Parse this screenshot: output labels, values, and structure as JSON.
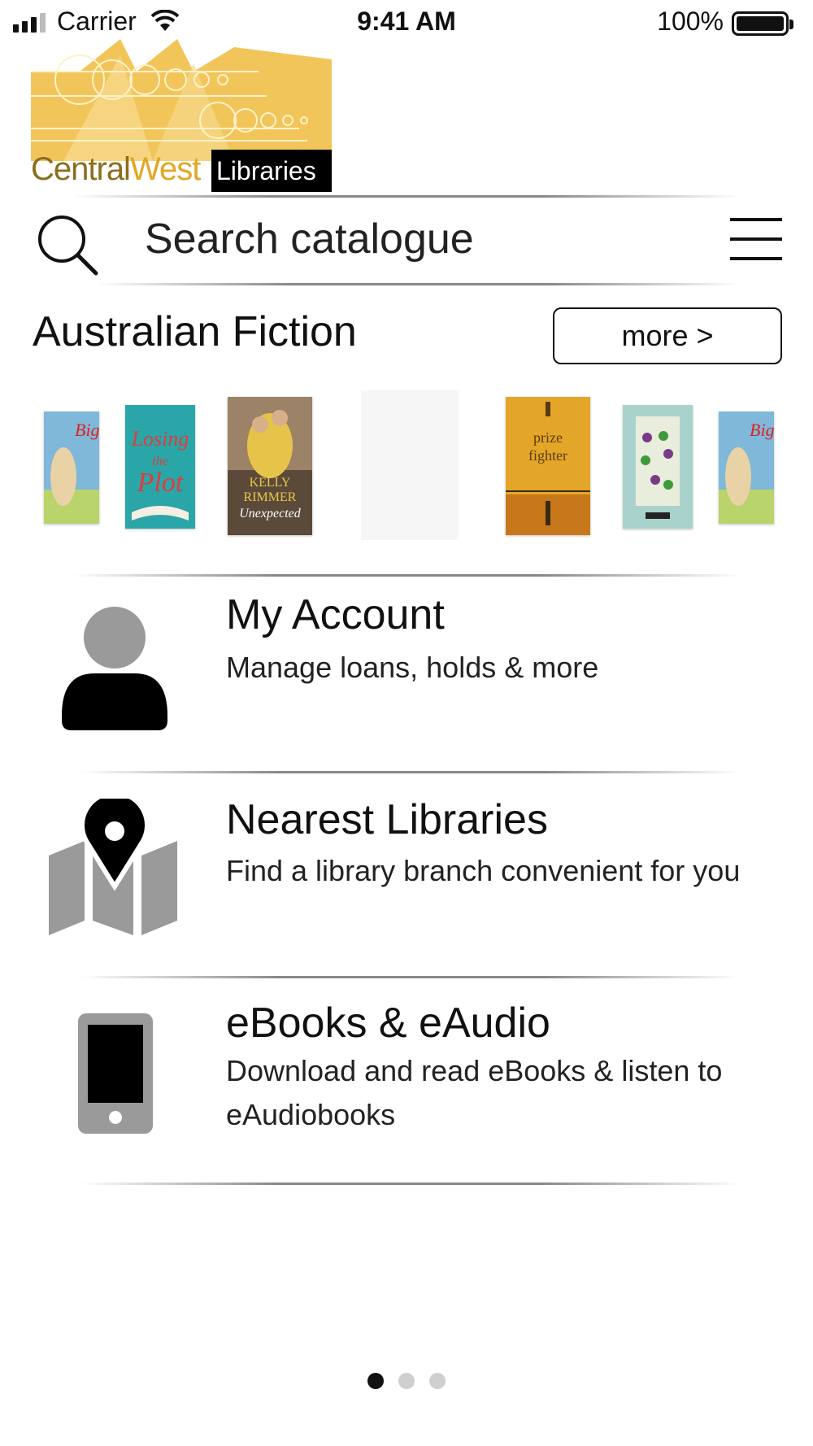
{
  "status_bar": {
    "carrier": "Carrier",
    "time": "9:41 AM",
    "battery": "100%"
  },
  "logo": {
    "text_main": "Central",
    "text_accent": "West",
    "badge": "Libraries"
  },
  "search": {
    "placeholder": "Search catalogue"
  },
  "featured": {
    "title": "Australian Fiction",
    "more_label": "more >",
    "books": [
      {
        "cover_color": "#7fb8d8"
      },
      {
        "cover_color": "#2aa6a8",
        "cover_text": "Losing the Plot"
      },
      {
        "cover_color": "#c9a34a",
        "cover_text": "KELLY RIMMER Unexpected"
      },
      {
        "cover_color": "#f4f4f4"
      },
      {
        "cover_color": "#e4a628",
        "cover_text": "prize fighter"
      },
      {
        "cover_color": "#a9d2cc"
      },
      {
        "cover_color": "#7fb8d8"
      }
    ]
  },
  "features": [
    {
      "title": "My Account",
      "description": "Manage loans, holds & more",
      "icon": "person-icon"
    },
    {
      "title": "Nearest Libraries",
      "description": "Find a library branch convenient for you",
      "icon": "map-pin-icon"
    },
    {
      "title": "eBooks & eAudio",
      "description": "Download and read eBooks & listen to eAudiobooks",
      "icon": "phone-icon"
    }
  ],
  "pager": {
    "pages": 3,
    "active": 1
  },
  "colors": {
    "logo_gold": "#f2c55b",
    "logo_brown": "#8a6d1e",
    "icon_gray": "#9a9a9a",
    "icon_black": "#000000"
  }
}
